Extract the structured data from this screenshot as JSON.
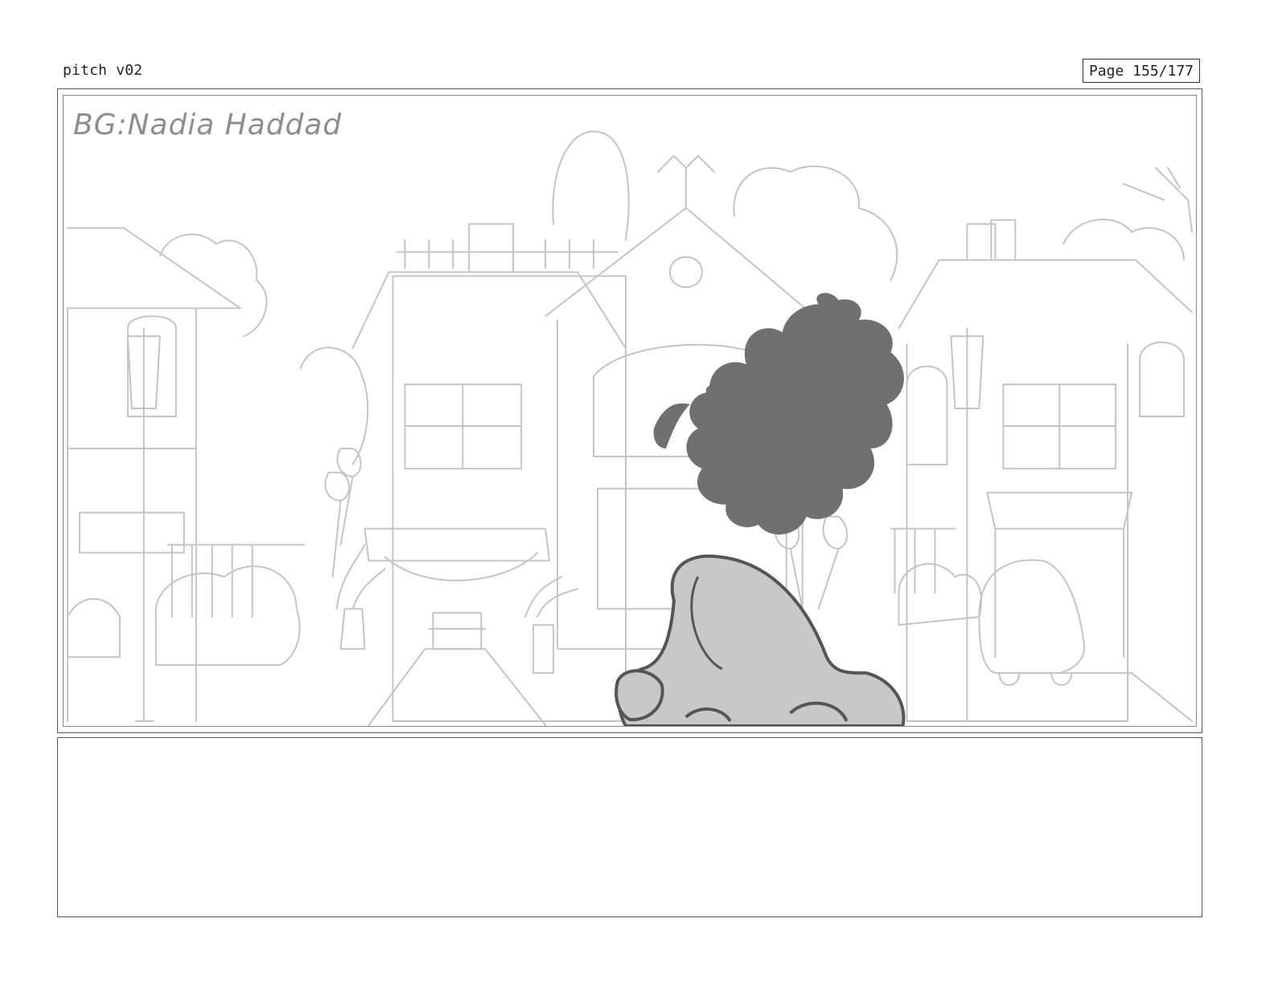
{
  "header": {
    "doc_title": "pitch v02",
    "page_counter": "Page 155/177"
  },
  "panel": {
    "credit": "BG:Nadia Haddad"
  },
  "notes": {
    "text": ""
  }
}
